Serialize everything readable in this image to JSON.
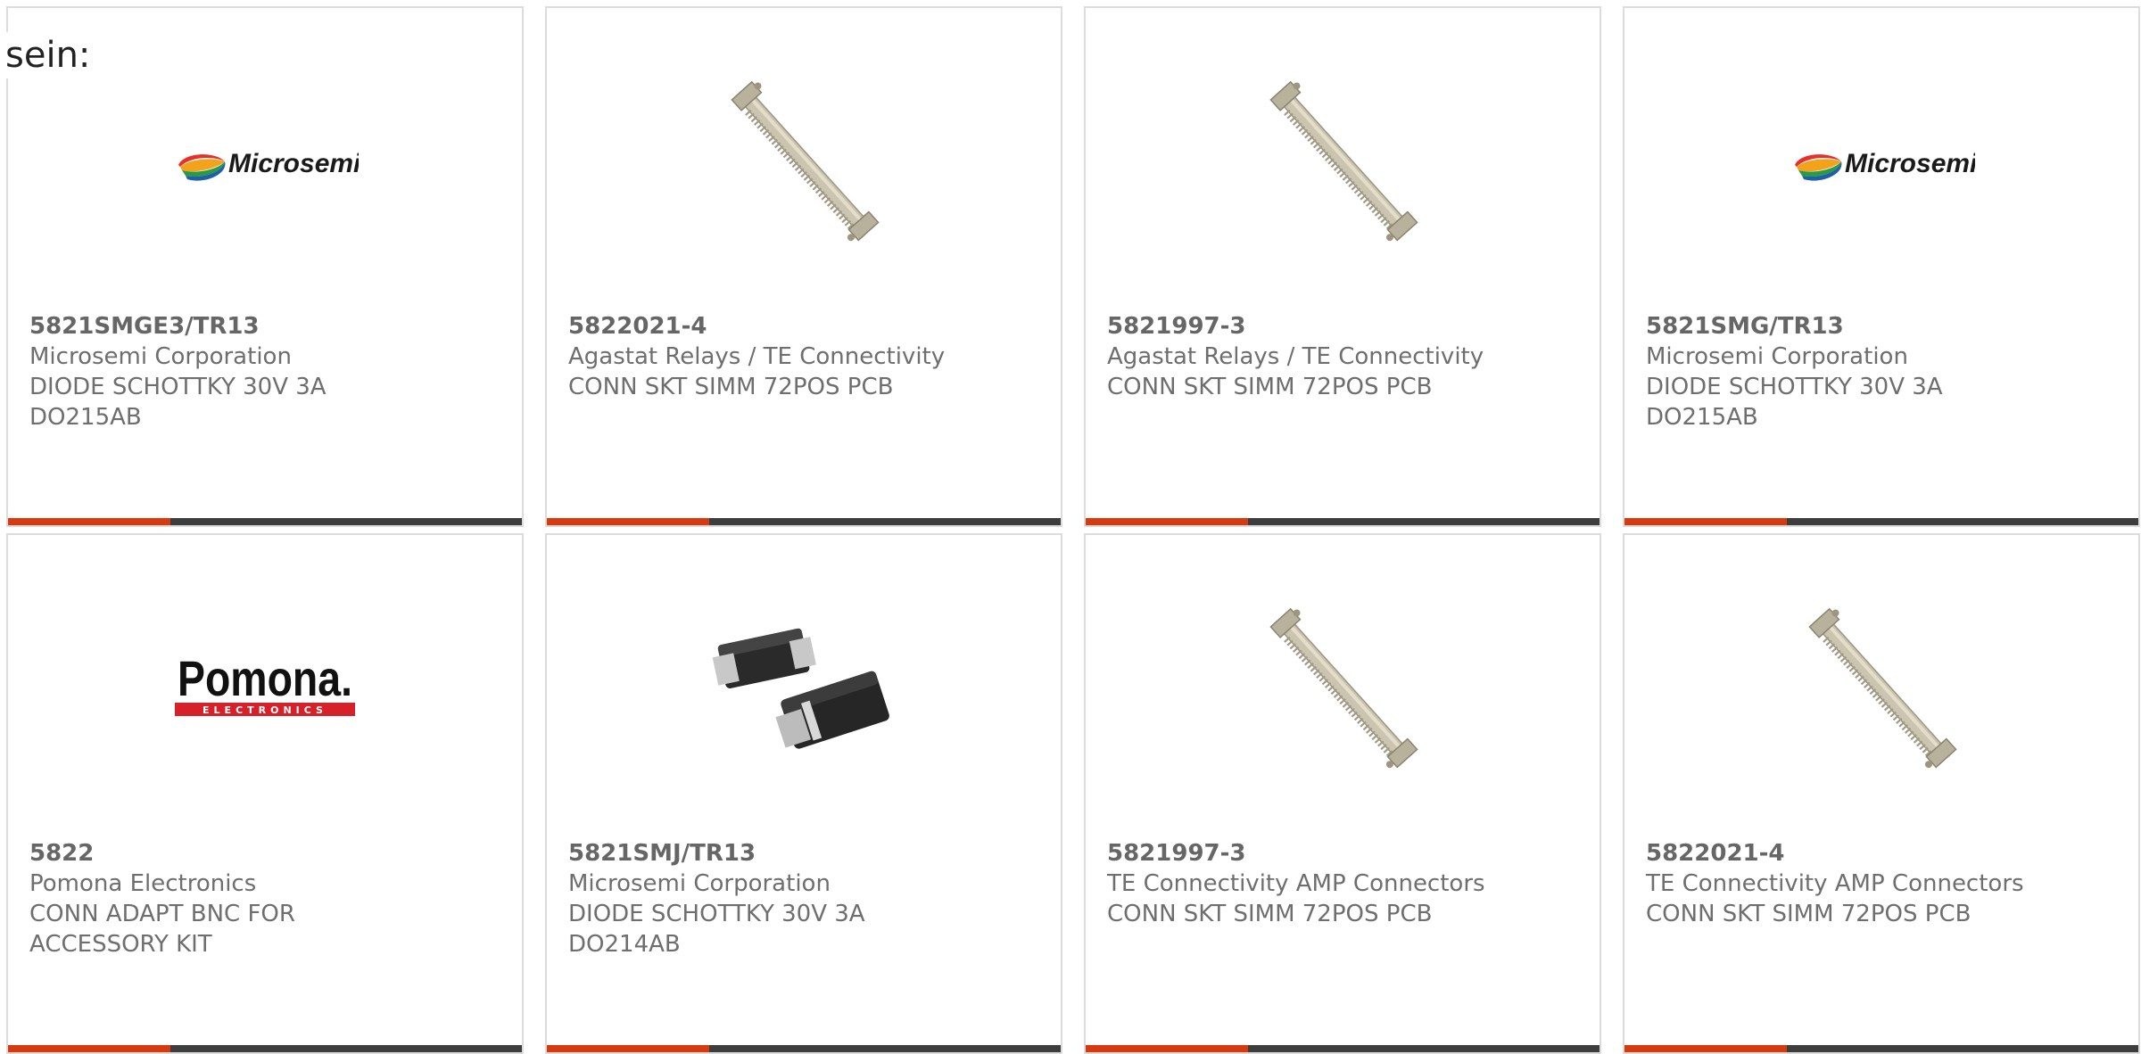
{
  "page": {
    "label": "sein:"
  },
  "theme": {
    "accent": "#d63a0e",
    "bar": "#3d3d3d",
    "border": "#dcdcdc",
    "text": "#6e6e6e"
  },
  "cards": [
    {
      "part_number": "5821SMGE3/TR13",
      "manufacturer": "Microsemi Corporation",
      "description": "DIODE SCHOTTKY 30V 3A DO215AB",
      "image": "microsemi-logo",
      "logo_text": "Microsemi"
    },
    {
      "part_number": "5822021-4",
      "manufacturer": "Agastat Relays / TE Connectivity",
      "description": "CONN SKT SIMM 72POS PCB",
      "image": "simm-socket"
    },
    {
      "part_number": "5821997-3",
      "manufacturer": "Agastat Relays / TE Connectivity",
      "description": "CONN SKT SIMM 72POS PCB",
      "image": "simm-socket"
    },
    {
      "part_number": "5821SMG/TR13",
      "manufacturer": "Microsemi Corporation",
      "description": "DIODE SCHOTTKY 30V 3A DO215AB",
      "image": "microsemi-logo",
      "logo_text": "Microsemi"
    },
    {
      "part_number": "5822",
      "manufacturer": "Pomona Electronics",
      "description": "CONN ADAPT BNC FOR ACCESSORY KIT",
      "image": "pomona-logo",
      "logo_text": "Pomona.",
      "logo_subtext": "ELECTRONICS"
    },
    {
      "part_number": "5821SMJ/TR13",
      "manufacturer": "Microsemi Corporation",
      "description": "DIODE SCHOTTKY 30V 3A DO214AB",
      "image": "smd-diode"
    },
    {
      "part_number": "5821997-3",
      "manufacturer": "TE Connectivity AMP Connectors",
      "description": "CONN SKT SIMM 72POS PCB",
      "image": "simm-socket"
    },
    {
      "part_number": "5822021-4",
      "manufacturer": "TE Connectivity AMP Connectors",
      "description": "CONN SKT SIMM 72POS PCB",
      "image": "simm-socket"
    }
  ]
}
